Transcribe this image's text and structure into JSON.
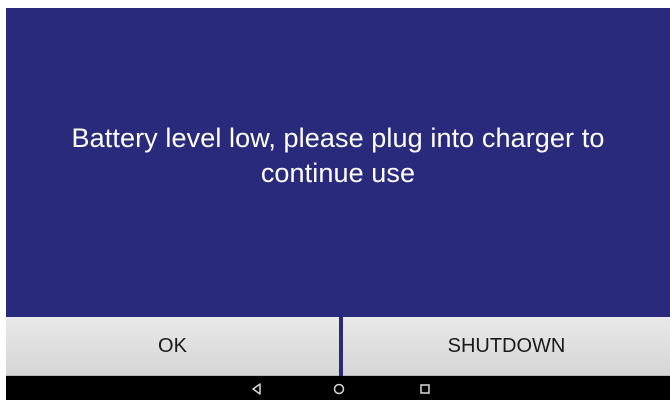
{
  "dialog": {
    "message": "Battery level low, please plug into charger to continue use",
    "ok_label": "OK",
    "shutdown_label": "SHUTDOWN"
  },
  "navigation_bar": {
    "icons": [
      "back-icon",
      "home-icon",
      "recent-apps-icon"
    ]
  },
  "colors": {
    "background": "#2a2a7d",
    "button": "#dedede",
    "navbar": "#000000",
    "text": "#ffffff"
  }
}
